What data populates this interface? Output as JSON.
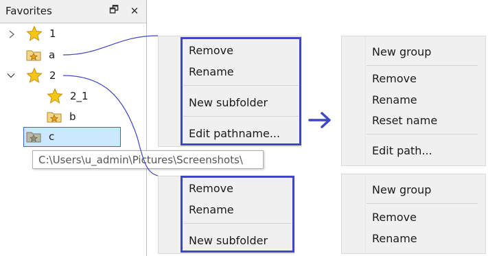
{
  "favorites_pane": {
    "title": "Favorites",
    "restore_glyph": "🗗",
    "close_glyph": "✕",
    "tree": [
      {
        "label": "1",
        "icon": "star-icon",
        "expandable": true,
        "expanded": false
      },
      {
        "label": "a",
        "icon": "star-folder-icon"
      },
      {
        "label": "2",
        "icon": "star-icon",
        "expandable": true,
        "expanded": true
      },
      {
        "label": "2_1",
        "icon": "star-icon"
      },
      {
        "label": "b",
        "icon": "star-folder-icon"
      },
      {
        "label": "c",
        "icon": "star-folder-gray-icon",
        "selected": true
      }
    ],
    "tooltip": "C:\\Users\\u_admin\\Pictures\\Screenshots\\"
  },
  "menu_a_original": {
    "items": [
      "Remove",
      "Rename",
      "New subfolder",
      "Edit pathname..."
    ]
  },
  "menu_a_new": {
    "items": [
      "New group",
      "Remove",
      "Rename",
      "Reset name",
      "Edit path..."
    ]
  },
  "menu_2_original": {
    "items": [
      "Remove",
      "Rename",
      "New subfolder"
    ]
  },
  "menu_2_new": {
    "items": [
      "New group",
      "Remove",
      "Rename"
    ]
  },
  "colors": {
    "highlight_border": "#3e46c4",
    "arrow": "#3e46c4",
    "selection_fill": "#cce8ff",
    "star": "#f5c518"
  }
}
